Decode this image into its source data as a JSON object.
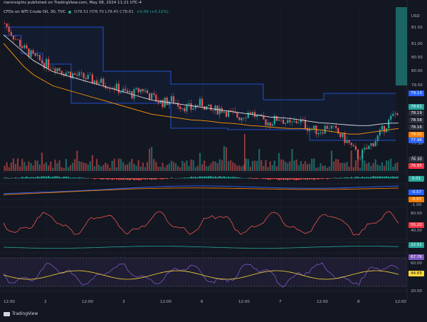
{
  "header": {
    "publisher": "rianinsights published on TradingView.com, May 08, 2024 11:21 UTC-4"
  },
  "legend": {
    "symbol": "CFDs on WTI Crude Oil, 30, TVC",
    "ohlc": "O78.51 H78.70 L78.45 C78.61",
    "change": "+0.09 (+0.12%)"
  },
  "axis": {
    "currency": "USD",
    "price_ticks": [
      "81.50",
      "81.00",
      "80.50",
      "80.00",
      "79.50",
      "77.50",
      "77.00"
    ],
    "x_ticks": [
      "12:00",
      "2",
      "12:00",
      "3",
      "12:00",
      "6",
      "12:00",
      "7",
      "12:00",
      "8",
      "12:00"
    ]
  },
  "price_tags": [
    {
      "label": "79.13",
      "color": "#2962ff"
    },
    {
      "label": "78.61",
      "color": "#26a69a"
    },
    {
      "label": "78.19",
      "color": "#2a2e39"
    },
    {
      "label": "78.58",
      "color": "#2a2e39"
    },
    {
      "label": "78.16",
      "color": "#2a2e39"
    },
    {
      "label": "78.00",
      "color": "#f57c00"
    },
    {
      "label": "77.96",
      "color": "#2962ff"
    },
    {
      "label": "76.30",
      "color": "#2a2e39"
    },
    {
      "label": "76.85",
      "color": "#f23645"
    }
  ],
  "indicator_tags": [
    {
      "label": "0.01",
      "color": "#26a69a"
    },
    {
      "label": "-0.57",
      "color": "#2962ff"
    },
    {
      "label": "-0.57",
      "color": "#f57c00"
    },
    {
      "label": "-1.00",
      "color": ""
    },
    {
      "label": "80.00",
      "color": ""
    },
    {
      "label": "55.20",
      "color": "#f23645"
    },
    {
      "label": "40.00",
      "color": ""
    },
    {
      "label": "22.51",
      "color": "#26a69a"
    },
    {
      "label": "67.76",
      "color": "#7e57c2"
    },
    {
      "label": "60.00",
      "color": ""
    },
    {
      "label": "44.65",
      "color": "#fdd835"
    },
    {
      "label": "20.00",
      "color": ""
    }
  ],
  "chart_data": {
    "type": "line",
    "series": [
      {
        "values": [
          81.7,
          81.2,
          80.8,
          80.5,
          80.3,
          80.2,
          80.0,
          79.9,
          79.8,
          79.7,
          79.6,
          79.5,
          79.3,
          79.2,
          79.4,
          79.1,
          78.9,
          79.0,
          78.8,
          78.7,
          78.9,
          78.6,
          78.7,
          78.5,
          78.4,
          78.6,
          78.3,
          78.2,
          78.4,
          78.1,
          78.3,
          78.0,
          77.9,
          78.1,
          77.8,
          77.5,
          77.0,
          77.3,
          77.7,
          78.2,
          78.61
        ]
      },
      {
        "values": [
          81.3,
          81.0,
          80.7,
          80.4,
          80.2,
          80.0,
          79.9,
          79.8,
          79.7,
          79.6,
          79.5,
          79.4,
          79.3,
          79.2,
          79.1,
          79.0,
          78.95,
          78.9,
          78.85,
          78.8,
          78.75,
          78.7,
          78.65,
          78.6,
          78.55,
          78.5,
          78.45,
          78.4,
          78.38,
          78.35,
          78.3,
          78.25,
          78.2,
          78.18,
          78.15,
          78.12,
          78.1,
          78.1,
          78.15,
          78.18,
          78.19
        ]
      },
      {
        "values": [
          81.0,
          80.6,
          80.2,
          79.9,
          79.7,
          79.5,
          79.4,
          79.3,
          79.2,
          79.1,
          79.0,
          78.9,
          78.8,
          78.7,
          78.6,
          78.5,
          78.45,
          78.4,
          78.35,
          78.3,
          78.28,
          78.25,
          78.2,
          78.18,
          78.15,
          78.1,
          78.08,
          78.05,
          78.02,
          78.0,
          78.0,
          77.98,
          77.95,
          77.9,
          77.85,
          77.8,
          77.8,
          77.85,
          77.9,
          77.95,
          78.0
        ]
      }
    ],
    "ylim": [
      76.7,
      81.9
    ]
  }
}
